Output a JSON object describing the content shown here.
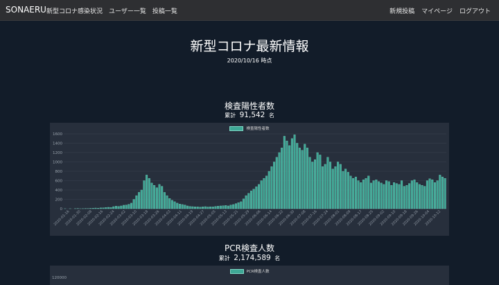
{
  "navbar": {
    "brand": "SONAERU",
    "left_items": [
      "新型コロナ感染状況",
      "ユーザー一覧",
      "投稿一覧"
    ],
    "right_items": [
      "新規投稿",
      "マイページ",
      "ログアウト"
    ]
  },
  "page": {
    "title": "新型コロナ最新情報",
    "date": "2020/10/16 時点"
  },
  "positive_section": {
    "title": "検査陽性者数",
    "total_prefix": "累計",
    "total_value": "91,542",
    "total_unit": "名"
  },
  "pcr_section": {
    "title": "PCR検査人数",
    "total_prefix": "累計",
    "total_value": "2,174,589",
    "total_unit": "名"
  },
  "colors": {
    "background": "#121c29",
    "navbar": "#2e2f32",
    "chart_background": "#272f3c",
    "bar_fill": "#3fa896",
    "bar_stroke": "#7fd8c6"
  },
  "chart_data": [
    {
      "type": "bar",
      "legend": "検査陽性者数",
      "legend_position": "top-center",
      "ylim": [
        0,
        1600
      ],
      "yticks": [
        0,
        200,
        400,
        600,
        800,
        1000,
        1200,
        1400,
        1600
      ],
      "grid": true,
      "series": [
        {
          "name": "検査陽性者数",
          "values": [
            1,
            0,
            1,
            0,
            2,
            3,
            1,
            2,
            5,
            3,
            8,
            10,
            15,
            12,
            18,
            20,
            25,
            30,
            28,
            45,
            55,
            50,
            60,
            75,
            80,
            95,
            120,
            200,
            280,
            350,
            400,
            600,
            720,
            650,
            550,
            500,
            450,
            520,
            480,
            350,
            280,
            220,
            180,
            150,
            120,
            100,
            90,
            80,
            60,
            50,
            45,
            40,
            40,
            35,
            40,
            45,
            38,
            42,
            40,
            50,
            55,
            60,
            65,
            70,
            60,
            80,
            90,
            110,
            130,
            150,
            210,
            280,
            330,
            380,
            420,
            470,
            520,
            600,
            650,
            700,
            800,
            900,
            1000,
            1100,
            1200,
            1300,
            1550,
            1450,
            1350,
            1500,
            1580,
            1400,
            1300,
            1250,
            1380,
            1300,
            1100,
            1000,
            1050,
            1200,
            1150,
            900,
            950,
            1100,
            1000,
            850,
            900,
            1000,
            950,
            800,
            850,
            780,
            700,
            650,
            680,
            600,
            560,
            620,
            650,
            700,
            550,
            600,
            620,
            580,
            550,
            520,
            600,
            580,
            500,
            560,
            540,
            520,
            600,
            480,
            500,
            540,
            600,
            620,
            560,
            520,
            500,
            480,
            600,
            640,
            620,
            560,
            600,
            720,
            680,
            650
          ]
        }
      ],
      "x_tick_labels": [
        "2020-01-16",
        "2020-01-30",
        "2020-02-08",
        "2020-02-16",
        "2020-02-24",
        "2020-03-02",
        "2020-03-10",
        "2020-03-18",
        "2020-03-26",
        "2020-04-03",
        "2020-04-11",
        "2020-04-19",
        "2020-04-27",
        "2020-05-05",
        "2020-05-13",
        "2020-05-21",
        "2020-05-29",
        "2020-06-06",
        "2020-06-14",
        "2020-06-22",
        "2020-06-30",
        "2020-07-08",
        "2020-07-16",
        "2020-07-24",
        "2020-08-01",
        "2020-08-09",
        "2020-08-17",
        "2020-08-25",
        "2020-09-02",
        "2020-09-10",
        "2020-09-18",
        "2020-09-26",
        "2020-10-04",
        "2020-10-12"
      ]
    },
    {
      "type": "bar",
      "legend": "PCR検査人数",
      "legend_position": "top-center",
      "yticks": [
        120000
      ],
      "grid": true,
      "series": [
        {
          "name": "PCR検査人数",
          "values": []
        }
      ]
    }
  ]
}
